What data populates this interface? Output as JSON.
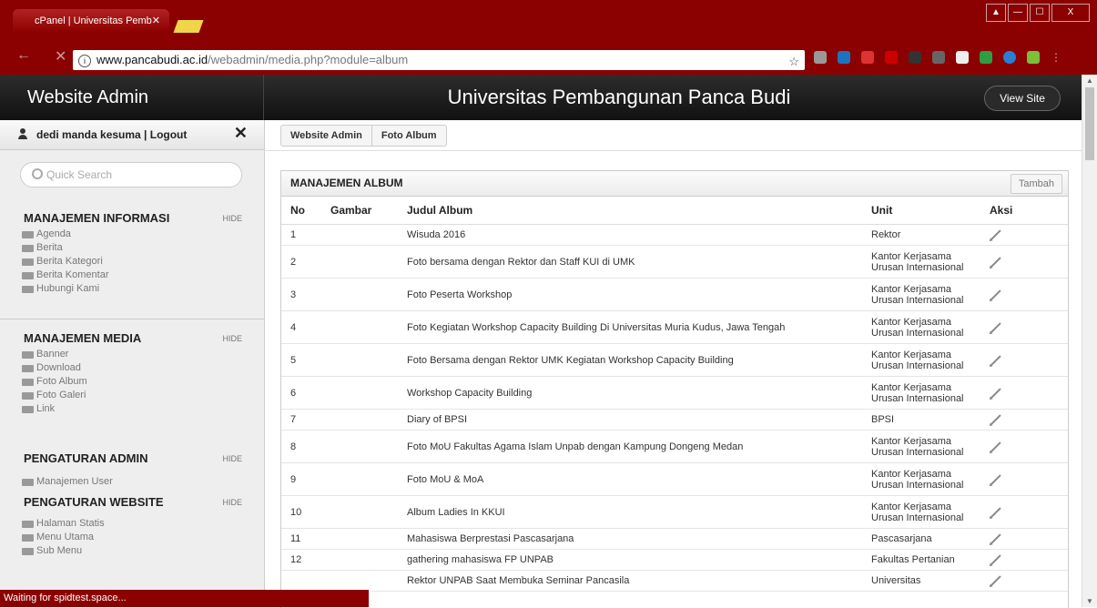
{
  "browser": {
    "tab_title": "cPanel | Universitas Pemb",
    "url_host": "www.pancabudi.ac.id",
    "url_path": "/webadmin/media.php?module=album",
    "status": "Waiting for spidtest.space...",
    "window_buttons": [
      "▲",
      "—",
      "☐",
      "X"
    ]
  },
  "header": {
    "brand": "Website Admin",
    "title": "Universitas Pembangunan Panca Budi",
    "view_site": "View Site"
  },
  "sidebar": {
    "user": "dedi manda kesuma | Logout",
    "search_placeholder": "Quick Search",
    "hide_label": "HIDE",
    "sections": [
      {
        "title": "MANAJEMEN INFORMASI",
        "items": [
          "Agenda",
          "Berita",
          "Berita Kategori",
          "Berita Komentar",
          "Hubungi Kami"
        ]
      },
      {
        "title": "MANAJEMEN MEDIA",
        "items": [
          "Banner",
          "Download",
          "Foto Album",
          "Foto Galeri",
          "Link"
        ]
      },
      {
        "title": "PENGATURAN ADMIN",
        "items": [
          "Manajemen User"
        ]
      },
      {
        "title": "PENGATURAN WEBSITE",
        "items": [
          "Halaman Statis",
          "Menu Utama",
          "Sub Menu"
        ]
      }
    ]
  },
  "breadcrumb": [
    "Website Admin",
    "Foto Album"
  ],
  "panel": {
    "title": "MANAJEMEN ALBUM",
    "add_button": "Tambah",
    "columns": [
      "No",
      "Gambar",
      "Judul Album",
      "Unit",
      "Aksi"
    ],
    "rows": [
      {
        "no": "1",
        "judul": "Wisuda 2016",
        "unit": "Rektor"
      },
      {
        "no": "2",
        "judul": "Foto bersama dengan Rektor dan Staff KUI di UMK",
        "unit": "Kantor Kerjasama Urusan Internasional"
      },
      {
        "no": "3",
        "judul": "Foto Peserta Workshop",
        "unit": "Kantor Kerjasama Urusan Internasional"
      },
      {
        "no": "4",
        "judul": "Foto Kegiatan Workshop Capacity Building Di Universitas Muria Kudus, Jawa Tengah",
        "unit": "Kantor Kerjasama Urusan Internasional"
      },
      {
        "no": "5",
        "judul": "Foto Bersama dengan Rektor UMK Kegiatan Workshop Capacity Building",
        "unit": "Kantor Kerjasama Urusan Internasional"
      },
      {
        "no": "6",
        "judul": "Workshop Capacity Building",
        "unit": "Kantor Kerjasama Urusan Internasional"
      },
      {
        "no": "7",
        "judul": "Diary of BPSI",
        "unit": "BPSI"
      },
      {
        "no": "8",
        "judul": "Foto MoU Fakultas Agama Islam Unpab dengan Kampung Dongeng Medan",
        "unit": "Kantor Kerjasama Urusan Internasional"
      },
      {
        "no": "9",
        "judul": "Foto MoU & MoA",
        "unit": "Kantor Kerjasama Urusan Internasional"
      },
      {
        "no": "10",
        "judul": "Album Ladies In KKUI",
        "unit": "Kantor Kerjasama Urusan Internasional"
      },
      {
        "no": "11",
        "judul": "Mahasiswa Berprestasi Pascasarjana",
        "unit": "Pascasarjana"
      },
      {
        "no": "12",
        "judul": "gathering mahasiswa FP UNPAB",
        "unit": "Fakultas Pertanian"
      },
      {
        "no": "",
        "judul": "Rektor UNPAB Saat Membuka Seminar Pancasila",
        "unit": "Universitas"
      }
    ]
  }
}
